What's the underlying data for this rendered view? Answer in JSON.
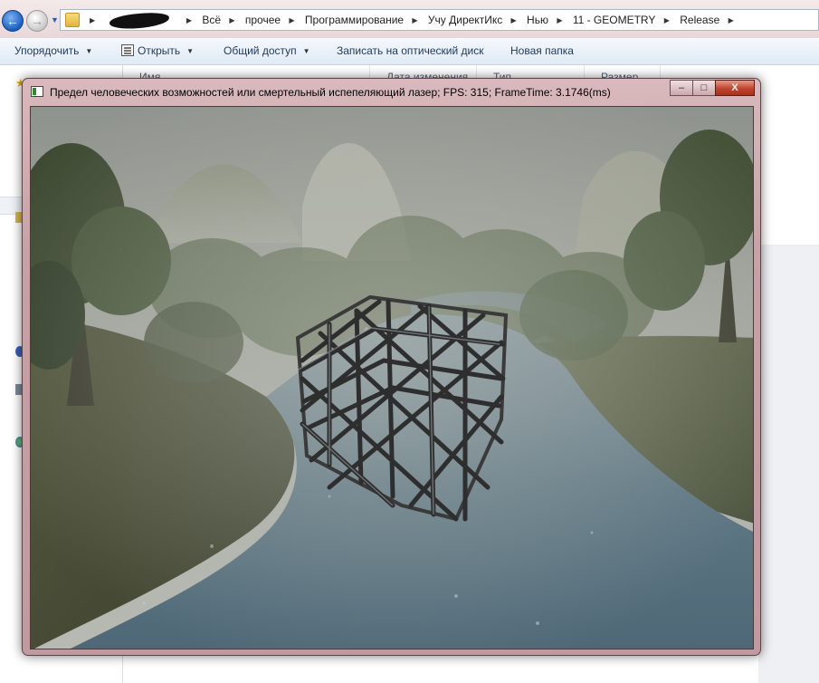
{
  "explorer": {
    "breadcrumbs": [
      "Всё",
      "прочее",
      "Программирование",
      "Учу ДиректИкс",
      "Нью",
      "11 - GEOMETRY",
      "Release"
    ],
    "toolbar": {
      "organize": "Упорядочить",
      "open": "Открыть",
      "share": "Общий доступ",
      "burn": "Записать на оптический диск",
      "new_folder": "Новая папка"
    },
    "columns": [
      "Имя",
      "Дата изменения",
      "Тип",
      "Размер"
    ]
  },
  "game_window": {
    "title": "Предел человеческих возможностей или смертельный испепеляющий лазер; FPS: 315; FrameTime: 3.1746(ms)",
    "controls": {
      "minimize": "–",
      "maximize": "□",
      "close": "X"
    }
  },
  "colors": {
    "accent_blue": "#1b5fbf",
    "window_frame": "#c7a1a6",
    "close_button": "#c1432d",
    "fog": "#a9ada4",
    "water": "#5a7483"
  }
}
